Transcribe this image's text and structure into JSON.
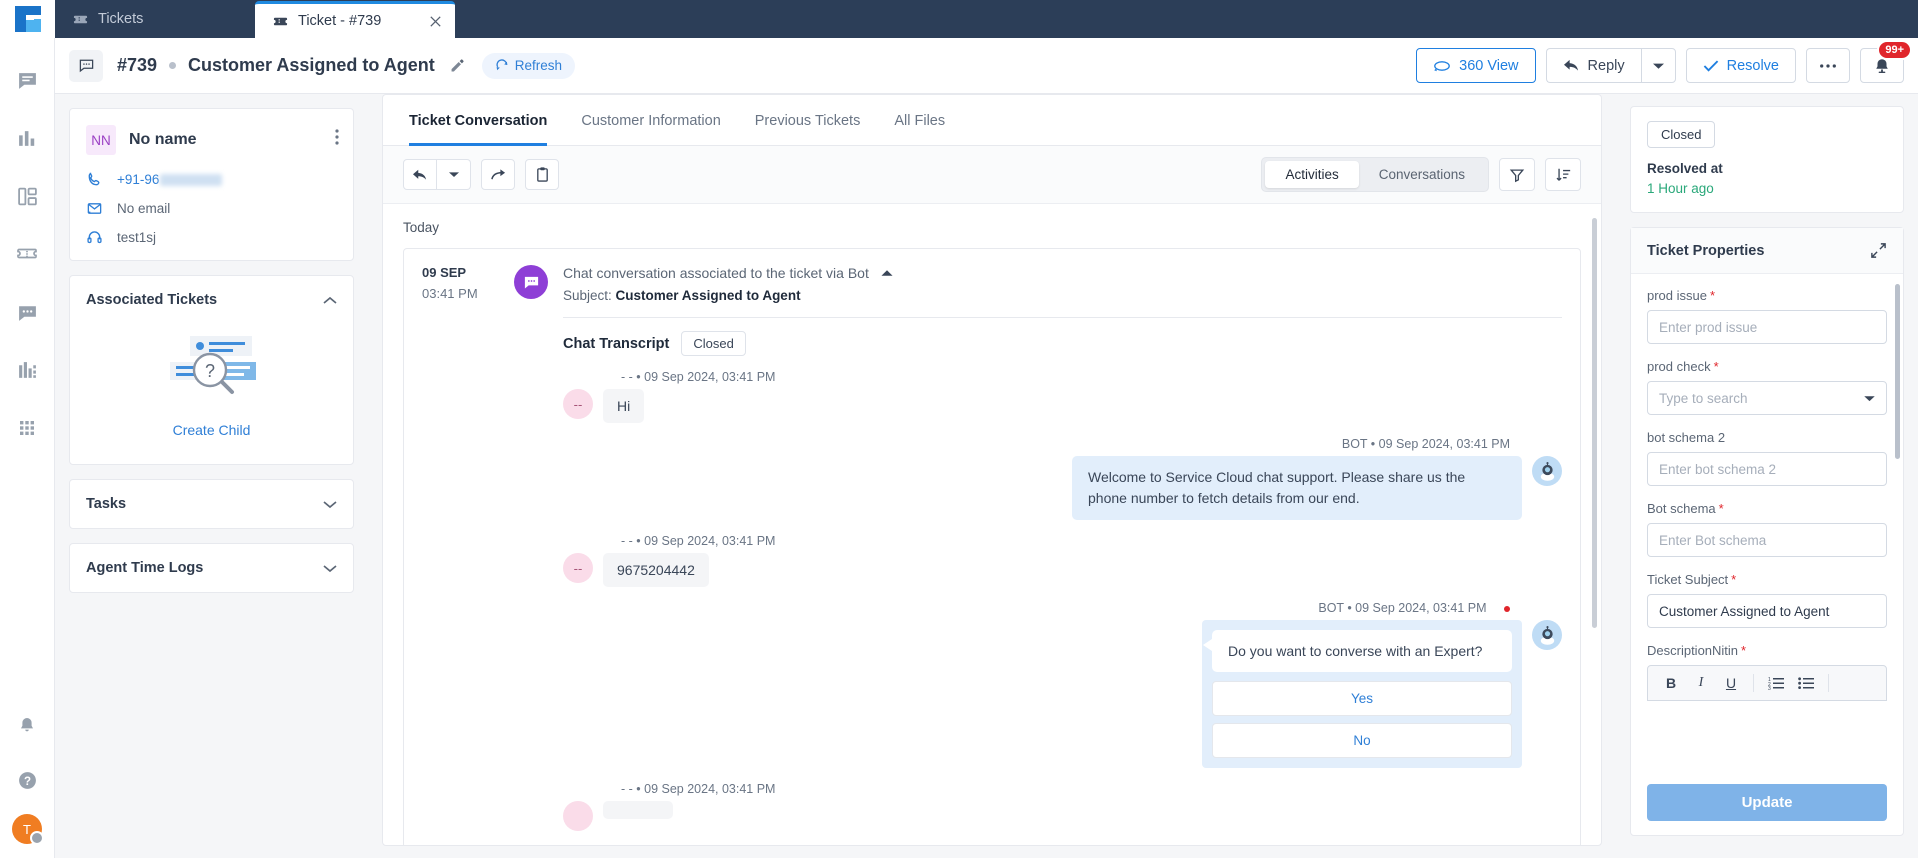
{
  "window": {
    "tabs": [
      {
        "label": "Tickets",
        "icon": "ticket-icon",
        "active": false
      },
      {
        "label": "Ticket - #739",
        "icon": "ticket-icon",
        "active": true
      }
    ]
  },
  "rail": {
    "items": [
      {
        "name": "chat-icon"
      },
      {
        "name": "bar-chart-icon"
      },
      {
        "name": "dashboard-icon"
      },
      {
        "name": "ticket-icon"
      },
      {
        "name": "message-icon"
      },
      {
        "name": "reports-icon"
      },
      {
        "name": "apps-grid-icon"
      }
    ],
    "bottom": [
      {
        "name": "bell-icon"
      },
      {
        "name": "help-icon"
      }
    ],
    "avatar_initial": "T"
  },
  "header": {
    "ticket_id": "#739",
    "title": "Customer Assigned to Agent",
    "refresh_label": "Refresh",
    "actions": {
      "view_360": "360 View",
      "reply": "Reply",
      "resolve": "Resolve",
      "more": "•••",
      "notification_badge": "99+"
    }
  },
  "contact": {
    "initials": "NN",
    "name": "No name",
    "phone": "+91-96",
    "email": "No email",
    "agent": "test1sj"
  },
  "associated": {
    "title": "Associated Tickets",
    "create_child": "Create Child"
  },
  "panels": [
    {
      "title": "Tasks"
    },
    {
      "title": "Agent Time Logs"
    }
  ],
  "main": {
    "tabs": [
      {
        "label": "Ticket Conversation",
        "active": true
      },
      {
        "label": "Customer Information",
        "active": false
      },
      {
        "label": "Previous Tickets",
        "active": false
      },
      {
        "label": "All Files",
        "active": false
      }
    ],
    "toolbar": {
      "reply_icon": "reply-icon",
      "reply_caret_icon": "chevron-down-icon",
      "forward_icon": "forward-icon",
      "note_icon": "clipboard-icon",
      "segment": [
        {
          "label": "Activities",
          "on": true
        },
        {
          "label": "Conversations",
          "on": false
        }
      ],
      "filter_icon": "filter-icon",
      "sort_icon": "sort-icon"
    },
    "day_label": "Today",
    "activity": {
      "date": "09 SEP",
      "time": "03:41 PM",
      "headline": "Chat conversation associated to the ticket via Bot",
      "subject_label": "Subject:",
      "subject_value": "Customer Assigned to Agent",
      "transcript_label": "Chat Transcript",
      "transcript_status": "Closed"
    },
    "messages": [
      {
        "side": "left",
        "meta": "- -  •  09 Sep 2024, 03:41 PM",
        "avatar": "--",
        "text": "Hi"
      },
      {
        "side": "right",
        "meta": "BOT • 09 Sep 2024, 03:41 PM",
        "text": "Welcome to Service Cloud chat support. Please share us the phone number to fetch details from our end."
      },
      {
        "side": "left",
        "meta": "- -  •  09 Sep 2024, 03:41 PM",
        "avatar": "--",
        "text": "9675204442"
      },
      {
        "side": "right",
        "meta": "BOT • 09 Sep 2024, 03:41 PM",
        "question": "Do you want to converse with an Expert?",
        "options": [
          "Yes",
          "No"
        ]
      },
      {
        "side": "left",
        "meta": "- -  •  09 Sep 2024, 03:41 PM",
        "avatar": "--",
        "text": ""
      }
    ]
  },
  "right": {
    "status": "Closed",
    "resolved_label": "Resolved at",
    "resolved_value": "1 Hour ago",
    "properties_title": "Ticket Properties",
    "expand_icon": "expand-icon",
    "fields": [
      {
        "label": "prod issue",
        "required": true,
        "type": "input",
        "placeholder": "Enter prod issue",
        "value": ""
      },
      {
        "label": "prod check",
        "required": true,
        "type": "select",
        "placeholder": "Type to search",
        "value": ""
      },
      {
        "label": "bot schema 2",
        "required": false,
        "type": "input",
        "placeholder": "Enter bot schema 2",
        "value": ""
      },
      {
        "label": "Bot schema",
        "required": true,
        "type": "input",
        "placeholder": "Enter Bot schema",
        "value": ""
      },
      {
        "label": "Ticket Subject",
        "required": true,
        "type": "input",
        "placeholder": "",
        "value": "Customer Assigned to Agent"
      },
      {
        "label": "DescriptionNitin",
        "required": true,
        "type": "richtext",
        "placeholder": "",
        "value": ""
      }
    ],
    "rte_buttons": [
      "B",
      "I",
      "U",
      "ordered-list-icon",
      "unordered-list-icon"
    ],
    "update_label": "Update"
  },
  "colors": {
    "accent": "#1f7fe0",
    "rail_bg": "#2c3e58",
    "bot_bubble": "#e2eefb",
    "resolved_green": "#2aa87a",
    "badge_red": "#e0252b"
  }
}
